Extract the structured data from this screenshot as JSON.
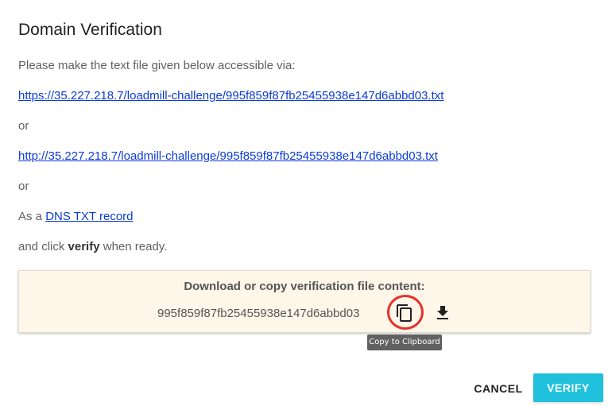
{
  "dialog": {
    "title": "Domain Verification",
    "intro": "Please make the text file given below accessible via:",
    "https_url": "https://35.227.218.7/loadmill-challenge/995f859f87fb25455938e147d6abbd03.txt",
    "or_1": "or",
    "http_url": "http://35.227.218.7/loadmill-challenge/995f859f87fb25455938e147d6abbd03.txt",
    "or_2": "or",
    "dns_prefix": "As a",
    "dns_link": "DNS TXT record",
    "click_prefix": "and click",
    "click_bold": "verify",
    "click_suffix": "when ready."
  },
  "verification_box": {
    "heading": "Download or copy verification file content:",
    "code": "995f859f87fb25455938e147d6abbd03",
    "copy_icon": "copy-icon",
    "download_icon": "download-icon",
    "tooltip": "Copy to Clipboard"
  },
  "actions": {
    "cancel_label": "CANCEL",
    "verify_label": "VERIFY"
  },
  "colors": {
    "link": "#0b3bd6",
    "verify_button": "#1fc1dd",
    "box_background": "#fdf6e9",
    "highlight": "#e5322d",
    "tooltip_background": "#616161"
  }
}
